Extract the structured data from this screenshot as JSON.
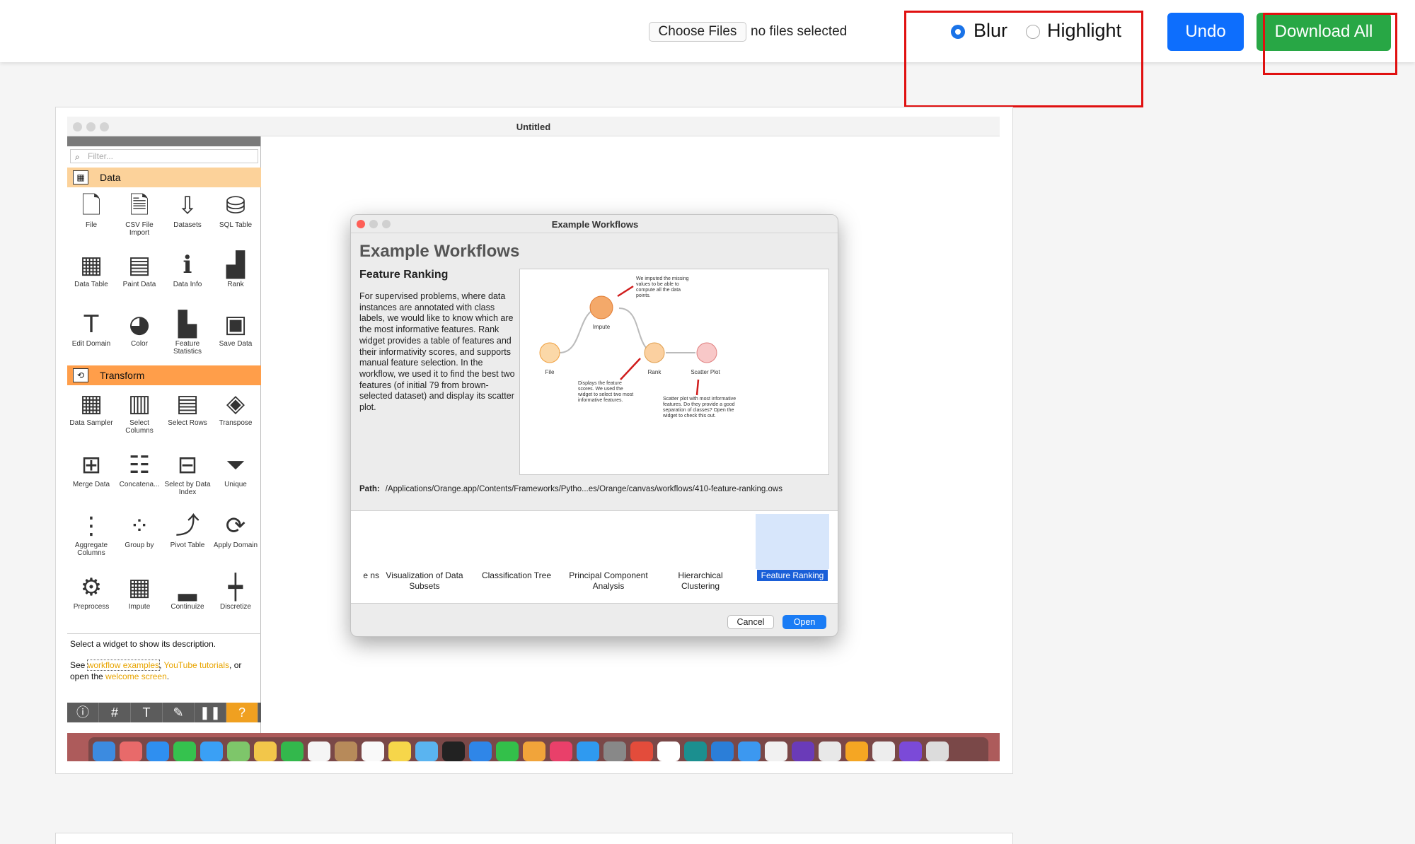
{
  "toolbar": {
    "choose_files": "Choose Files",
    "no_files": "no files selected",
    "mode_blur": "Blur",
    "mode_highlight": "Highlight",
    "selected_mode": "Blur",
    "undo": "Undo",
    "download_all": "Download All",
    "colors": {
      "undo": "#0d6efd",
      "download": "#28a745",
      "highlight_box": "#e01010"
    }
  },
  "screenshot": {
    "window_title": "Untitled",
    "sidebar": {
      "filter_placeholder": "Filter...",
      "categories": {
        "data": "Data",
        "transform": "Transform"
      },
      "data_widgets": [
        {
          "label": "File",
          "icon": "file-icon"
        },
        {
          "label": "CSV File Import",
          "icon": "csv-icon"
        },
        {
          "label": "Datasets",
          "icon": "datasets-icon"
        },
        {
          "label": "SQL Table",
          "icon": "database-icon"
        },
        {
          "label": "Data Table",
          "icon": "table-icon"
        },
        {
          "label": "Paint Data",
          "icon": "paint-icon"
        },
        {
          "label": "Data Info",
          "icon": "info-icon"
        },
        {
          "label": "Rank",
          "icon": "rank-icon"
        },
        {
          "label": "Edit Domain",
          "icon": "edit-icon"
        },
        {
          "label": "Color",
          "icon": "palette-icon"
        },
        {
          "label": "Feature Statistics",
          "icon": "stats-icon"
        },
        {
          "label": "Save Data",
          "icon": "save-icon"
        }
      ],
      "transform_widgets": [
        {
          "label": "Data Sampler",
          "icon": "sampler-icon"
        },
        {
          "label": "Select Columns",
          "icon": "select-columns-icon"
        },
        {
          "label": "Select Rows",
          "icon": "select-rows-icon"
        },
        {
          "label": "Transpose",
          "icon": "transpose-icon"
        },
        {
          "label": "Merge Data",
          "icon": "merge-icon"
        },
        {
          "label": "Concatena...",
          "icon": "concatenate-icon"
        },
        {
          "label": "Select by Data Index",
          "icon": "index-icon"
        },
        {
          "label": "Unique",
          "icon": "filter-icon"
        },
        {
          "label": "Aggregate Columns",
          "icon": "aggregate-icon"
        },
        {
          "label": "Group by",
          "icon": "group-icon"
        },
        {
          "label": "Pivot Table",
          "icon": "pivot-icon"
        },
        {
          "label": "Apply Domain",
          "icon": "apply-icon"
        },
        {
          "label": "Preprocess",
          "icon": "gears-icon"
        },
        {
          "label": "Impute",
          "icon": "impute-icon"
        },
        {
          "label": "Continuize",
          "icon": "continuize-icon"
        },
        {
          "label": "Discretize",
          "icon": "discretize-icon"
        }
      ],
      "description": {
        "line1": "Select a widget to show its description.",
        "see": "See ",
        "link1": "workflow examples",
        "comma": ", ",
        "link2": "YouTube tutorials",
        "or_open": ", or open the ",
        "link3": "welcome screen",
        "end": "."
      },
      "bottom_tools": [
        "info-icon",
        "grid-icon",
        "text-icon",
        "pen-icon",
        "pause-icon",
        "help-icon"
      ]
    },
    "dialog": {
      "title": "Example Workflows",
      "heading": "Example Workflows",
      "subheading": "Feature Ranking",
      "description": "For supervised problems, where data instances are annotated with class labels, we would like to know which are the most informative features. Rank widget provides a table of features and their informativity scores, and supports manual feature selection. In the workflow, we used it to find the best two features (of initial 79 from brown-selected dataset) and display its scatter plot.",
      "preview": {
        "nodes": {
          "file": "File",
          "impute": "Impute",
          "rank": "Rank",
          "scatter": "Scatter Plot"
        },
        "notes": {
          "impute": "We imputed the missing values to be able to compute all the data points.",
          "rank": "Displays the feature scores. We used the widget to select two most informative features.",
          "scatter": "Scatter plot with most informative features. Do they provide a good separation of classes? Open the widget to check this out."
        }
      },
      "path_label": "Path:",
      "path_value": "/Applications/Orange.app/Contents/Frameworks/Pytho...es/Orange/canvas/workflows/410-feature-ranking.ows",
      "thumbnails": [
        {
          "label": "e ns"
        },
        {
          "label": "Visualization of Data Subsets"
        },
        {
          "label": "Classification Tree"
        },
        {
          "label": "Principal Component Analysis"
        },
        {
          "label": "Hierarchical Clustering"
        },
        {
          "label": "Feature Ranking"
        }
      ],
      "selected_thumbnail": "Feature Ranking",
      "cancel": "Cancel",
      "open": "Open"
    }
  }
}
